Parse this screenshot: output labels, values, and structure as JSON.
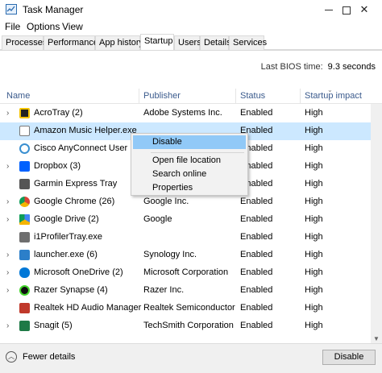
{
  "window": {
    "title": "Task Manager",
    "close_glyph": "✕"
  },
  "menu": [
    "File",
    "Options",
    "View"
  ],
  "tabs": [
    "Processes",
    "Performance",
    "App history",
    "Startup",
    "Users",
    "Details",
    "Services"
  ],
  "bios": {
    "label": "Last BIOS time:",
    "value": "9.3 seconds"
  },
  "columns": [
    "Name",
    "Publisher",
    "Status",
    "Startup impact"
  ],
  "rows": [
    {
      "name": "AcroTray (2)",
      "publisher": "Adobe Systems Inc.",
      "status": "Enabled",
      "impact": "High",
      "icon_color": "#222222"
    },
    {
      "name": "Amazon Music Helper.exe",
      "publisher": "",
      "status": "Enabled",
      "impact": "High",
      "icon_color": "#7a7a7a"
    },
    {
      "name": "Cisco AnyConnect User Inte...",
      "publisher": "",
      "status": "Enabled",
      "impact": "High",
      "icon_color": "#3a8fd0"
    },
    {
      "name": "Dropbox (3)",
      "publisher": "",
      "status": "Enabled",
      "impact": "High",
      "icon_color": "#0061fe"
    },
    {
      "name": "Garmin Express Tray",
      "publisher": "",
      "status": "Enabled",
      "impact": "High",
      "icon_color": "#555555"
    },
    {
      "name": "Google Chrome (26)",
      "publisher": "Google Inc.",
      "status": "Enabled",
      "impact": "High",
      "icon_color": "#db4437"
    },
    {
      "name": "Google Drive (2)",
      "publisher": "Google",
      "status": "Enabled",
      "impact": "High",
      "icon_color": "#0f9d58"
    },
    {
      "name": "i1ProfilerTray.exe",
      "publisher": "",
      "status": "Enabled",
      "impact": "High",
      "icon_color": "#6e6e6e"
    },
    {
      "name": "launcher.exe (6)",
      "publisher": "Synology Inc.",
      "status": "Enabled",
      "impact": "High",
      "icon_color": "#2c7fc9"
    },
    {
      "name": "Microsoft OneDrive (2)",
      "publisher": "Microsoft Corporation",
      "status": "Enabled",
      "impact": "High",
      "icon_color": "#0078d7"
    },
    {
      "name": "Razer Synapse (4)",
      "publisher": "Razer Inc.",
      "status": "Enabled",
      "impact": "High",
      "icon_color": "#44d62c"
    },
    {
      "name": "Realtek HD Audio Manager",
      "publisher": "Realtek Semiconductor",
      "status": "Enabled",
      "impact": "High",
      "icon_color": "#c0392b"
    },
    {
      "name": "Snagit (5)",
      "publisher": "TechSmith Corporation",
      "status": "Enabled",
      "impact": "High",
      "icon_color": "#1e7a46"
    }
  ],
  "context_menu": [
    "Disable",
    "Open file location",
    "Search online",
    "Properties"
  ],
  "footer": {
    "fewer_details": "Fewer details",
    "disable_button": "Disable"
  },
  "colors": {
    "selected_row": "#cce8ff",
    "menu_highlight": "#91c9f7",
    "header_text": "#3a5a8c"
  }
}
